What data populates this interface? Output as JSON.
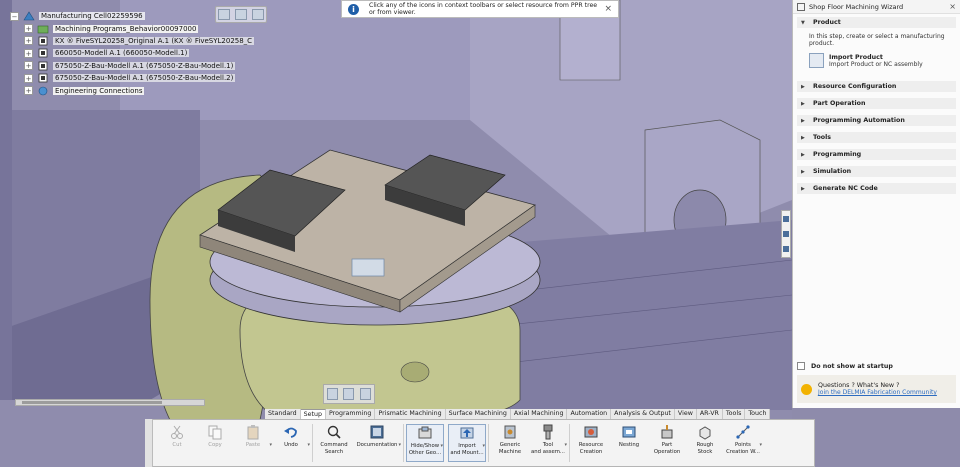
{
  "tree": {
    "items": [
      {
        "label": "Manufacturing Cell02259596",
        "level": 0,
        "expander": "−",
        "icon": "manufacturing-cell-icon"
      },
      {
        "label": "Machining Programs_Behavior00097000",
        "level": 1,
        "expander": "+",
        "icon": "machining-program-icon"
      },
      {
        "label": "KX ® FiveSYL20258_Original A.1 (KX ® FiveSYL20258_C",
        "level": 1,
        "expander": "+",
        "icon": "product-icon"
      },
      {
        "label": "660050-Modell A.1 (660050-Modell.1)",
        "level": 1,
        "expander": "+",
        "icon": "product-icon"
      },
      {
        "label": "675050-Z-Bau-Modell A.1 (675050-Z-Bau-Modell.1)",
        "level": 1,
        "expander": "+",
        "icon": "product-icon"
      },
      {
        "label": "675050-Z-Bau-Modell A.1 (675050-Z-Bau-Modell.2)",
        "level": 1,
        "expander": "+",
        "icon": "product-icon"
      },
      {
        "label": "Engineering Connections",
        "level": 1,
        "expander": "+",
        "icon": "engineering-connections-icon"
      }
    ]
  },
  "info_message": {
    "text": "Click any of the icons in context toolbars or select resource from PPR tree or from viewer.",
    "close": "×"
  },
  "panel": {
    "title": "Shop Floor Machining Wizard",
    "close": "×",
    "product": {
      "heading": "Product",
      "description": "In this step, create or select a manufacturing product.",
      "import_title": "Import Product",
      "import_sub": "Import Product or NC assembly"
    },
    "sections": [
      "Resource Configuration",
      "Part Operation",
      "Programming Automation",
      "Tools",
      "Programming",
      "Simulation",
      "Generate NC Code"
    ],
    "do_not_show": "Do not show at startup",
    "questions": "Questions ? What's New ?",
    "community_link": "Join the DELMIA Fabrication Community"
  },
  "action_tabs": [
    "Standard",
    "Setup",
    "Programming",
    "Prismatic Machining",
    "Surface Machining",
    "Axial Machining",
    "Automation",
    "Analysis & Output",
    "View",
    "AR-VR",
    "Tools",
    "Touch"
  ],
  "active_tab": "Setup",
  "commands": [
    {
      "label": "Cut",
      "icon": "scissors-icon",
      "dim": true,
      "drop": false
    },
    {
      "label": "Copy",
      "icon": "copy-icon",
      "dim": true,
      "drop": false
    },
    {
      "label": "Paste",
      "icon": "paste-icon",
      "dim": true,
      "drop": true
    },
    {
      "label": "Undo",
      "icon": "undo-icon",
      "dim": false,
      "drop": true
    },
    {
      "label": "Command\nSearch",
      "icon": "search-icon",
      "dim": false,
      "drop": false
    },
    {
      "label": "Documentation",
      "icon": "book-icon",
      "dim": false,
      "drop": true
    },
    {
      "label": "Hide/Show\nOther Geo...",
      "icon": "hide-show-icon",
      "dim": false,
      "drop": true,
      "boxed": true
    },
    {
      "label": "Import\nand Mount...",
      "icon": "import-mount-icon",
      "dim": false,
      "drop": true,
      "boxed": true
    },
    {
      "label": "Generic\nMachine",
      "icon": "generic-machine-icon",
      "dim": false,
      "drop": false
    },
    {
      "label": "Tool\nand assem...",
      "icon": "tool-assembly-icon",
      "dim": false,
      "drop": true
    },
    {
      "label": "Resource\nCreation",
      "icon": "resource-creation-icon",
      "dim": false,
      "drop": false
    },
    {
      "label": "Nesting",
      "icon": "nesting-icon",
      "dim": false,
      "drop": false
    },
    {
      "label": "Part\nOperation",
      "icon": "part-operation-icon",
      "dim": false,
      "drop": false
    },
    {
      "label": "Rough\nStock",
      "icon": "rough-stock-icon",
      "dim": false,
      "drop": false
    },
    {
      "label": "Points\nCreation W...",
      "icon": "points-creation-icon",
      "dim": false,
      "drop": true
    }
  ]
}
